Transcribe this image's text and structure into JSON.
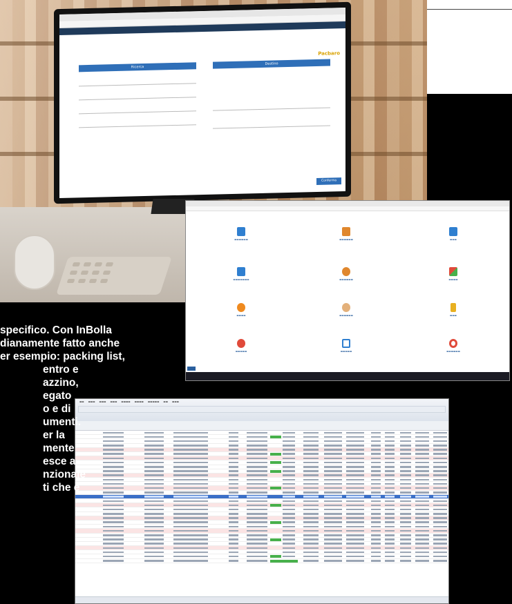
{
  "body_text": [
    "specifico. Con InBolla",
    "dianamente fatto anche",
    "er esempio: packing list,",
    "entro e",
    "azzino,",
    "egato",
    "o e di",
    "umenti.",
    "er la",
    "mente",
    "esce a",
    "nzionale",
    "ti che è"
  ],
  "monitor_form": {
    "brand": "Pacbaro",
    "left_header": "Ricerca",
    "right_header": "Destino",
    "confirm_button": "Conferma"
  },
  "colors": {
    "accent_blue": "#2f6fb8",
    "logo_gold": "#d9a200",
    "row_highlight": "#3a6fc7",
    "row_pink": "#fbe4e4",
    "progress_green": "#47b04b"
  }
}
